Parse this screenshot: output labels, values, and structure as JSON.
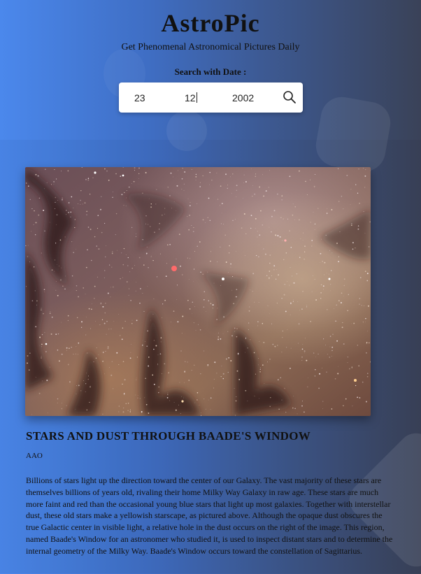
{
  "header": {
    "title": "AstroPic",
    "subtitle": "Get Phenomenal Astronomical Pictures Daily",
    "search_label": "Search with Date :"
  },
  "search": {
    "day": "23",
    "month": "12",
    "year": "2002",
    "button_icon": "search-icon"
  },
  "apod": {
    "title": "STARS AND DUST THROUGH BAADE'S WINDOW",
    "credit": "AAO",
    "explanation": "Billions of stars light up the direction toward the center of our Galaxy. The vast majority of these stars are themselves billions of years old, rivaling their home Milky Way Galaxy in raw age. These stars are much more faint and red than the occasional young blue stars that light up most galaxies. Together with interstellar dust, these old stars make a yellowish starscape, as pictured above. Although the opaque dust obscures the true Galactic center in visible light, a relative hole in the dust occurs on the right of the image. This region, named Baade's Window for an astronomer who studied it, is used to inspect distant stars and to determine the internal geometry of the Milky Way. Baade's Window occurs toward the constellation of Sagittarius."
  },
  "colors": {
    "background_left": "#4b88ec",
    "background_right": "#3a4258"
  }
}
